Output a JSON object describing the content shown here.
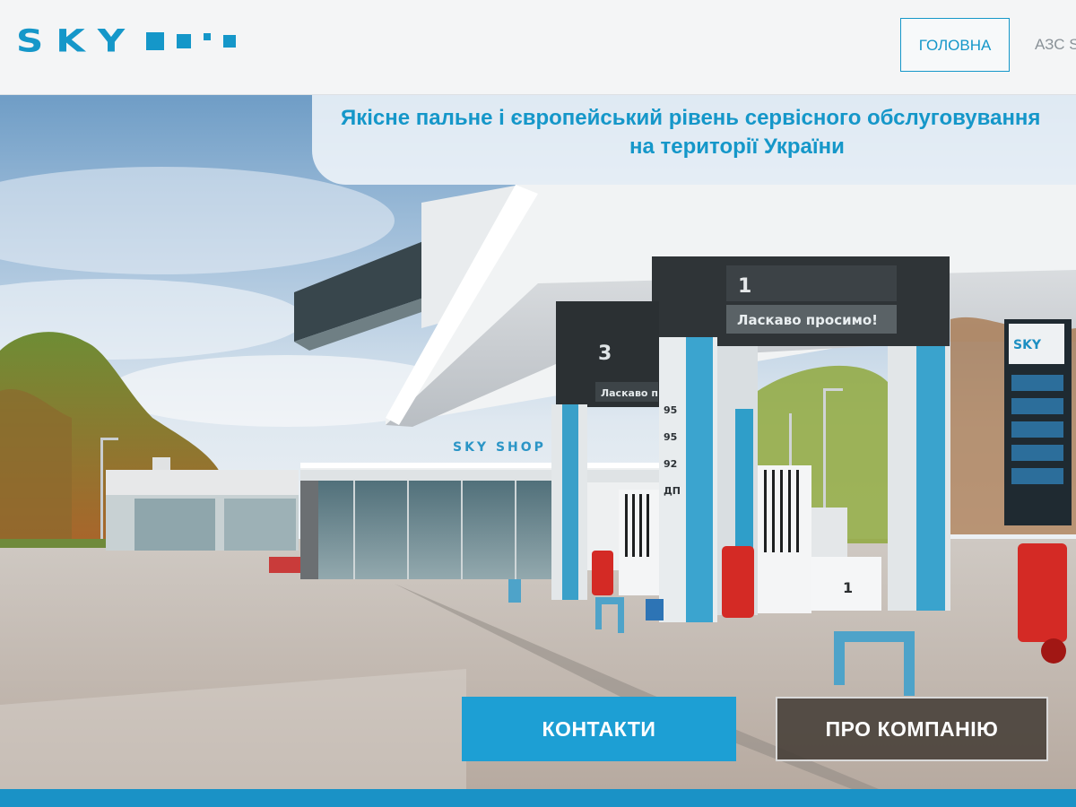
{
  "header": {
    "logo_text": "SKY",
    "nav": {
      "home_label": "ГОЛОВНА",
      "stations_label": "АЗС SKY"
    }
  },
  "hero": {
    "tagline_line1": "Якісне пальне і європейський рівень сервісного обслуговування",
    "tagline_line2": "на території України",
    "scene": {
      "canopy_pump_number": "1",
      "canopy_welcome": "Ласкаво просимо!",
      "second_pump_number": "3",
      "second_welcome": "Ласкаво п",
      "shop_sign": "SKY SHOP",
      "pillar_fuel_labels": [
        "95",
        "95",
        "92",
        "ДП"
      ],
      "dispenser_number": "1",
      "price_board_brand": "SKY"
    }
  },
  "buttons": {
    "contacts_label": "КОНТАКТИ",
    "about_label": "ПРО КОМПАНІЮ"
  },
  "colors": {
    "brand_blue": "#1597c9",
    "button_blue": "#1d9fd4",
    "button_dark": "#463e37",
    "footer_blue": "#1a92c6"
  }
}
